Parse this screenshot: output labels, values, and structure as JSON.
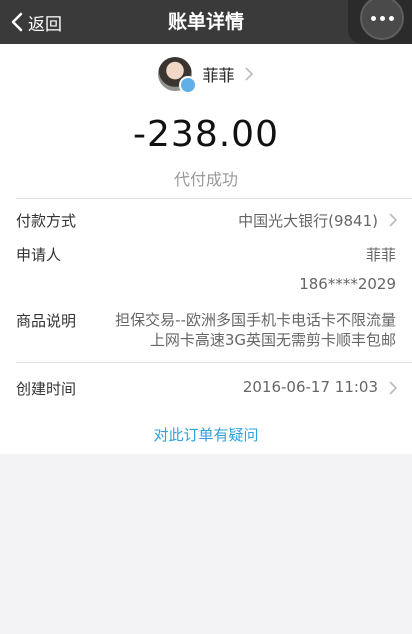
{
  "nav": {
    "back_label": "返回",
    "title": "账单详情"
  },
  "user": {
    "name": "菲菲"
  },
  "bill": {
    "amount": "-238.00",
    "status": "代付成功"
  },
  "details": {
    "payment_method": {
      "label": "付款方式",
      "value": "中国光大银行(9841)"
    },
    "applicant": {
      "label": "申请人",
      "name": "菲菲",
      "phone": "186****2029"
    },
    "goods": {
      "label": "商品说明",
      "line1": "担保交易--欧洲多国手机卡电话卡不限流量",
      "line2": "上网卡高速3G英国无需剪卡顺丰包邮"
    },
    "created": {
      "label": "创建时间",
      "value": "2016-06-17 11:03"
    }
  },
  "dispute_link": "对此订单有疑问",
  "colors": {
    "accent": "#2ea2dd",
    "topbar": "#3a3a3a"
  }
}
